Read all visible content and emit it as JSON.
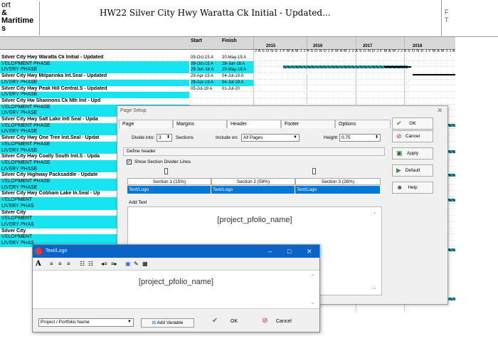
{
  "header": {
    "logo_lines": [
      "ort",
      "& Maritime",
      "s"
    ],
    "title": "HW22 Silver City Hwy Waratta Ck Initial - Updated...",
    "corner": [
      "F",
      "T"
    ]
  },
  "gantt": {
    "col_start": "Start",
    "col_finish": "Finish",
    "years": [
      "2015",
      "2016",
      "2017",
      "2018"
    ],
    "months": "J A S O N D J F M A M J J A S O N D J F M A M J J A S O N D J F M A M J J A S O N D J F M A M J J A S O N D",
    "rows": [
      {
        "name": "Silver City Hwy Waratta Ck Initial - Updated",
        "start": "09-Oct-15 A",
        "finish": "20-May-19 A",
        "kind": "s"
      },
      {
        "name": "VELOPMENT PHASE",
        "start": "09-Oct-15 A",
        "finish": "29-Jun-18 A",
        "kind": "p"
      },
      {
        "name": "LIVERY PHASE",
        "start": "29-Jun-18 A",
        "finish": "20-May-19 A",
        "kind": "p"
      },
      {
        "name": "Silver City Hwy Milparinka Int.Seal - Updated",
        "start": "29-Apr-19 A",
        "finish": "04-Jul-19 A",
        "kind": "s"
      },
      {
        "name": "LIVERY PHASE",
        "start": "29-Apr-19 A",
        "finish": "04-Jul-19 A",
        "kind": "p"
      },
      {
        "name": "Silver City Hwy Peak Hill Central.S - Updated",
        "start": "05-Jul-19 A",
        "finish": "01-Jul-20",
        "kind": "s"
      },
      {
        "name": "LIVERY PHASE",
        "start": "",
        "finish": "",
        "kind": "p"
      },
      {
        "name": "Silver City Hw Shannons Ck Nth Init - Upd",
        "start": "",
        "finish": "",
        "kind": "s"
      },
      {
        "name": "VELOPMENT PHASE",
        "start": "",
        "finish": "",
        "kind": "p"
      },
      {
        "name": "LIVERY PHASE",
        "start": "",
        "finish": "",
        "kind": "p"
      },
      {
        "name": "Silver City Hwy Salt Lake Intl Seal - Upda",
        "start": "",
        "finish": "",
        "kind": "s"
      },
      {
        "name": "VELOPMENT PHASE",
        "start": "",
        "finish": "",
        "kind": "p"
      },
      {
        "name": "LIVERY PHASE",
        "start": "",
        "finish": "",
        "kind": "p"
      },
      {
        "name": "Silver City Hwy One Tree Init.Seal - Updat",
        "start": "",
        "finish": "",
        "kind": "s"
      },
      {
        "name": "VELOPMENT PHASE",
        "start": "",
        "finish": "",
        "kind": "p"
      },
      {
        "name": "LIVERY PHASE",
        "start": "",
        "finish": "",
        "kind": "p"
      },
      {
        "name": "Silver City Hwy Coally South Init.S - Upda",
        "start": "",
        "finish": "",
        "kind": "s"
      },
      {
        "name": "VELOPMENT PHASE",
        "start": "",
        "finish": "",
        "kind": "p"
      },
      {
        "name": "LIVERY PHASE",
        "start": "",
        "finish": "",
        "kind": "p"
      },
      {
        "name": "Silver City Highway Packsaddle - Update",
        "start": "",
        "finish": "",
        "kind": "s"
      },
      {
        "name": "VELOPMENT PHASE",
        "start": "",
        "finish": "",
        "kind": "p"
      },
      {
        "name": "LIVERY PHASE",
        "start": "",
        "finish": "",
        "kind": "p"
      },
      {
        "name": "Silver City Hwy Cobham Lake In.Seal - Up",
        "start": "",
        "finish": "",
        "kind": "s"
      },
      {
        "name": "VELOPMENT",
        "start": "",
        "finish": "",
        "kind": "p"
      },
      {
        "name": "LIVERY PHAS",
        "start": "",
        "finish": "",
        "kind": "p"
      },
      {
        "name": "Silver City",
        "start": "",
        "finish": "",
        "kind": "s"
      },
      {
        "name": "VELOPMENT",
        "start": "",
        "finish": "",
        "kind": "p"
      },
      {
        "name": "LIVERY PHAS",
        "start": "",
        "finish": "",
        "kind": "p"
      },
      {
        "name": "Silver City",
        "start": "",
        "finish": "",
        "kind": "s"
      },
      {
        "name": "VELOPMENT",
        "start": "",
        "finish": "",
        "kind": "p"
      },
      {
        "name": "LIVERY PHAS",
        "start": "",
        "finish": "",
        "kind": "p"
      }
    ]
  },
  "page_setup": {
    "title": "Page Setup",
    "close": "✕",
    "tabs": [
      "Page",
      "Margins",
      "Header",
      "Footer",
      "Options"
    ],
    "divide_label": "Divide into:",
    "divide_value": "3",
    "sections_label": "Sections",
    "include_label": "Include on:",
    "include_value": "All Pages",
    "height_label": "Height:",
    "height_value": "0.75",
    "define_header": "Define header",
    "show_lines": "Show Section Divider Lines",
    "sections": [
      "Section 1 (15%)",
      "Section 2 (59%)",
      "Section 3 (26%)"
    ],
    "section_values": [
      "Text/Logo",
      "Text/Logo",
      "Text/Logo"
    ],
    "add_text": "Add Text",
    "add_text_value": "[project_pfolio_name]",
    "buttons": [
      "OK",
      "Cancel",
      "Apply",
      "Default",
      "Help"
    ]
  },
  "text_logo": {
    "title": "Text/Logo",
    "editor_value": "[project_pfolio_name]",
    "variable_value": "Project / Portfolio Name",
    "add_variable": "Add Variable",
    "ok": "OK",
    "cancel": "Cancel",
    "toolbar": [
      "A",
      "≡",
      "≡",
      "≡",
      "☷",
      "☷",
      "◂≡",
      "≡▸",
      "▣",
      "✎",
      "▦"
    ]
  },
  "colors": {
    "phase": "#16e4ef",
    "accent": "#0078d7",
    "titlebar": "#0a64c8"
  }
}
